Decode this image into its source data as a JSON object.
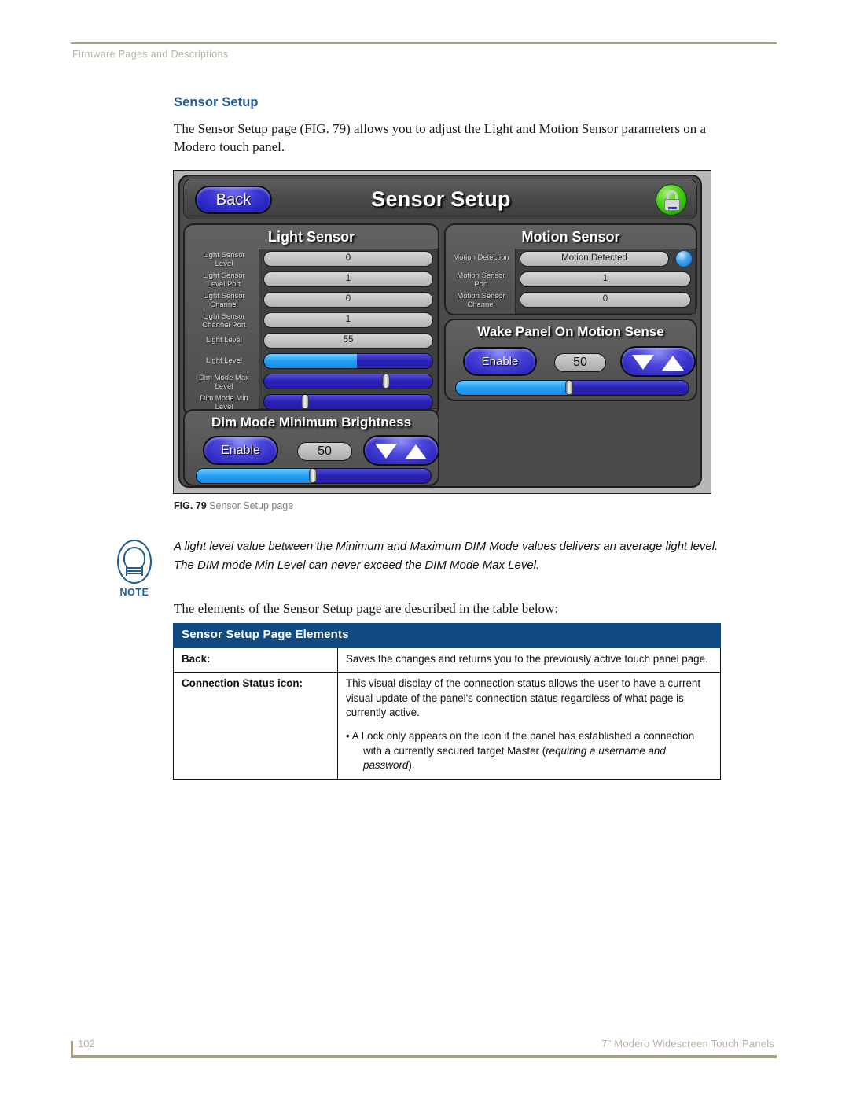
{
  "header": {
    "running_title": "Firmware Pages and Descriptions"
  },
  "section": {
    "heading": "Sensor Setup",
    "intro": "The Sensor Setup page (FIG. 79) allows you to adjust the Light and Motion Sensor parameters on a Modero touch panel.",
    "lead_in": "The elements of the Sensor Setup page are described in the table below:"
  },
  "figure": {
    "caption_label": "FIG. 79",
    "caption_text": "Sensor Setup page"
  },
  "panel": {
    "back_button": "Back",
    "title": "Sensor Setup",
    "lock_icon": "connection-status-lock-icon",
    "light_sensor": {
      "group_title": "Light Sensor",
      "fields": [
        {
          "label": "Light Sensor\nLevel",
          "value": "0"
        },
        {
          "label": "Light Sensor\nLevel Port",
          "value": "1"
        },
        {
          "label": "Light Sensor\nChannel",
          "value": "0"
        },
        {
          "label": "Light Sensor\nChannel Port",
          "value": "1"
        },
        {
          "label": "Light Level",
          "value": "55"
        }
      ],
      "sliders": [
        {
          "label": "Light Level",
          "fill_percent": 55,
          "thumb_percent": null
        },
        {
          "label": "Dim Mode Max\nLevel",
          "fill_percent": 0,
          "thumb_percent": 72
        },
        {
          "label": "Dim Mode Min\nLevel",
          "fill_percent": 0,
          "thumb_percent": 24
        }
      ]
    },
    "dim_mode": {
      "group_title": "Dim Mode Minimum Brightness",
      "enable_label": "Enable",
      "value": "50",
      "down_icon": "arrow-down-icon",
      "up_icon": "arrow-up-icon",
      "slider_fill_percent": 50
    },
    "motion_sensor": {
      "group_title": "Motion Sensor",
      "fields": [
        {
          "label": "Motion Detection",
          "value": "Motion Detected"
        },
        {
          "label": "Motion Sensor\nPort",
          "value": "1"
        },
        {
          "label": "Motion Sensor\nChannel",
          "value": "0"
        }
      ],
      "indicator_icon": "motion-indicator-dot"
    },
    "wake_panel": {
      "group_title": "Wake Panel On Motion Sense",
      "enable_label": "Enable",
      "value": "50",
      "down_icon": "arrow-down-icon",
      "up_icon": "arrow-up-icon",
      "slider_fill_percent": 50
    }
  },
  "note": {
    "icon_word": "NOTE",
    "text": "A light level value between the Minimum and Maximum DIM Mode values delivers an average light level. The DIM mode Min Level can never exceed the DIM Mode Max Level."
  },
  "table": {
    "title": "Sensor Setup Page Elements",
    "rows": [
      {
        "label": "Back:",
        "paragraphs": [
          {
            "style": "plain",
            "text": "Saves the changes and returns you to the previously active touch panel page."
          }
        ]
      },
      {
        "label": "Connection Status icon:",
        "paragraphs": [
          {
            "style": "plain",
            "text": "This visual display of the connection status allows the user to have a current visual update of the panel's connection status regardless of what page is currently active."
          },
          {
            "style": "bullet",
            "text": "• A Lock only appears on the icon if the panel has established a connection",
            "cont_pre": "with a currently secured target Master (",
            "cont_em": "requiring a username and password",
            "cont_post": ")."
          }
        ]
      }
    ]
  },
  "footer": {
    "page_number": "102",
    "doc_title": "7\" Modero Widescreen Touch Panels"
  },
  "colors": {
    "heading_blue": "#1f5b96",
    "table_header_blue": "#104a80",
    "rule_tan": "#a79d80",
    "panel_button_blue": "#2a22b5",
    "lock_green": "#4fd217"
  }
}
